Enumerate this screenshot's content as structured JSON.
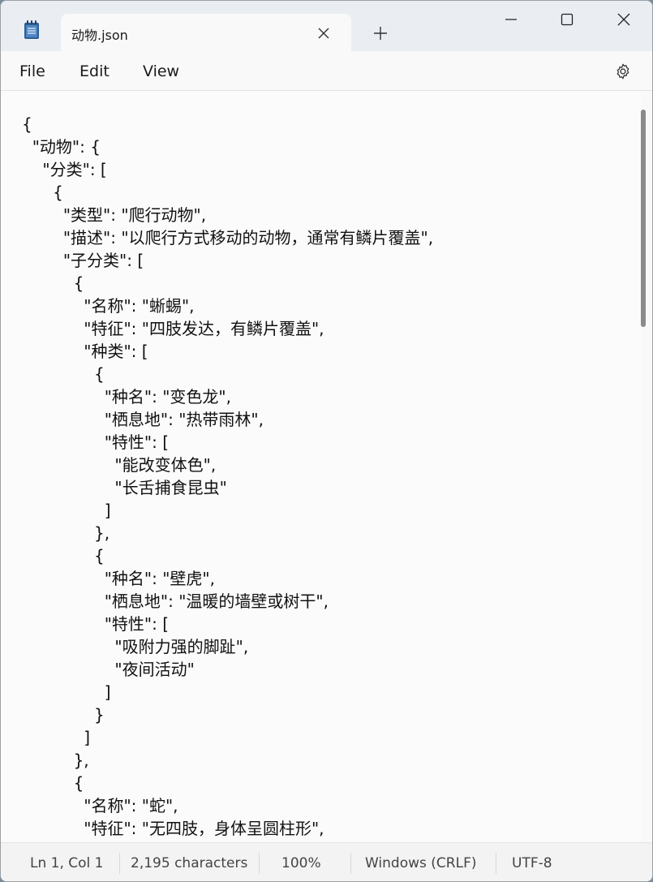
{
  "window": {
    "tab_title": "动物.json",
    "icons": {
      "app": "notepad-icon",
      "close_tab": "close-icon",
      "new_tab": "plus-icon",
      "minimize": "minimize-icon",
      "maximize": "maximize-icon",
      "close_window": "close-icon",
      "settings": "gear-icon"
    }
  },
  "menu": {
    "file": "File",
    "edit": "Edit",
    "view": "View"
  },
  "editor": {
    "lines": [
      "{",
      "  \"动物\": {",
      "    \"分类\": [",
      "      {",
      "        \"类型\": \"爬行动物\",",
      "        \"描述\": \"以爬行方式移动的动物，通常有鳞片覆盖\",",
      "        \"子分类\": [",
      "          {",
      "            \"名称\": \"蜥蜴\",",
      "            \"特征\": \"四肢发达，有鳞片覆盖\",",
      "            \"种类\": [",
      "              {",
      "                \"种名\": \"变色龙\",",
      "                \"栖息地\": \"热带雨林\",",
      "                \"特性\": [",
      "                  \"能改变体色\",",
      "                  \"长舌捕食昆虫\"",
      "                ]",
      "              },",
      "              {",
      "                \"种名\": \"壁虎\",",
      "                \"栖息地\": \"温暖的墙壁或树干\",",
      "                \"特性\": [",
      "                  \"吸附力强的脚趾\",",
      "                  \"夜间活动\"",
      "                ]",
      "              }",
      "            ]",
      "          },",
      "          {",
      "            \"名称\": \"蛇\",",
      "            \"特征\": \"无四肢，身体呈圆柱形\","
    ]
  },
  "status": {
    "position": "Ln 1, Col 1",
    "characters": "2,195 characters",
    "zoom": "100%",
    "line_ending": "Windows (CRLF)",
    "encoding": "UTF-8"
  },
  "colors": {
    "titlebar_bg": "#eaeef3",
    "editor_bg": "#fbfbfb",
    "app_icon_blue": "#3a6ea5"
  }
}
